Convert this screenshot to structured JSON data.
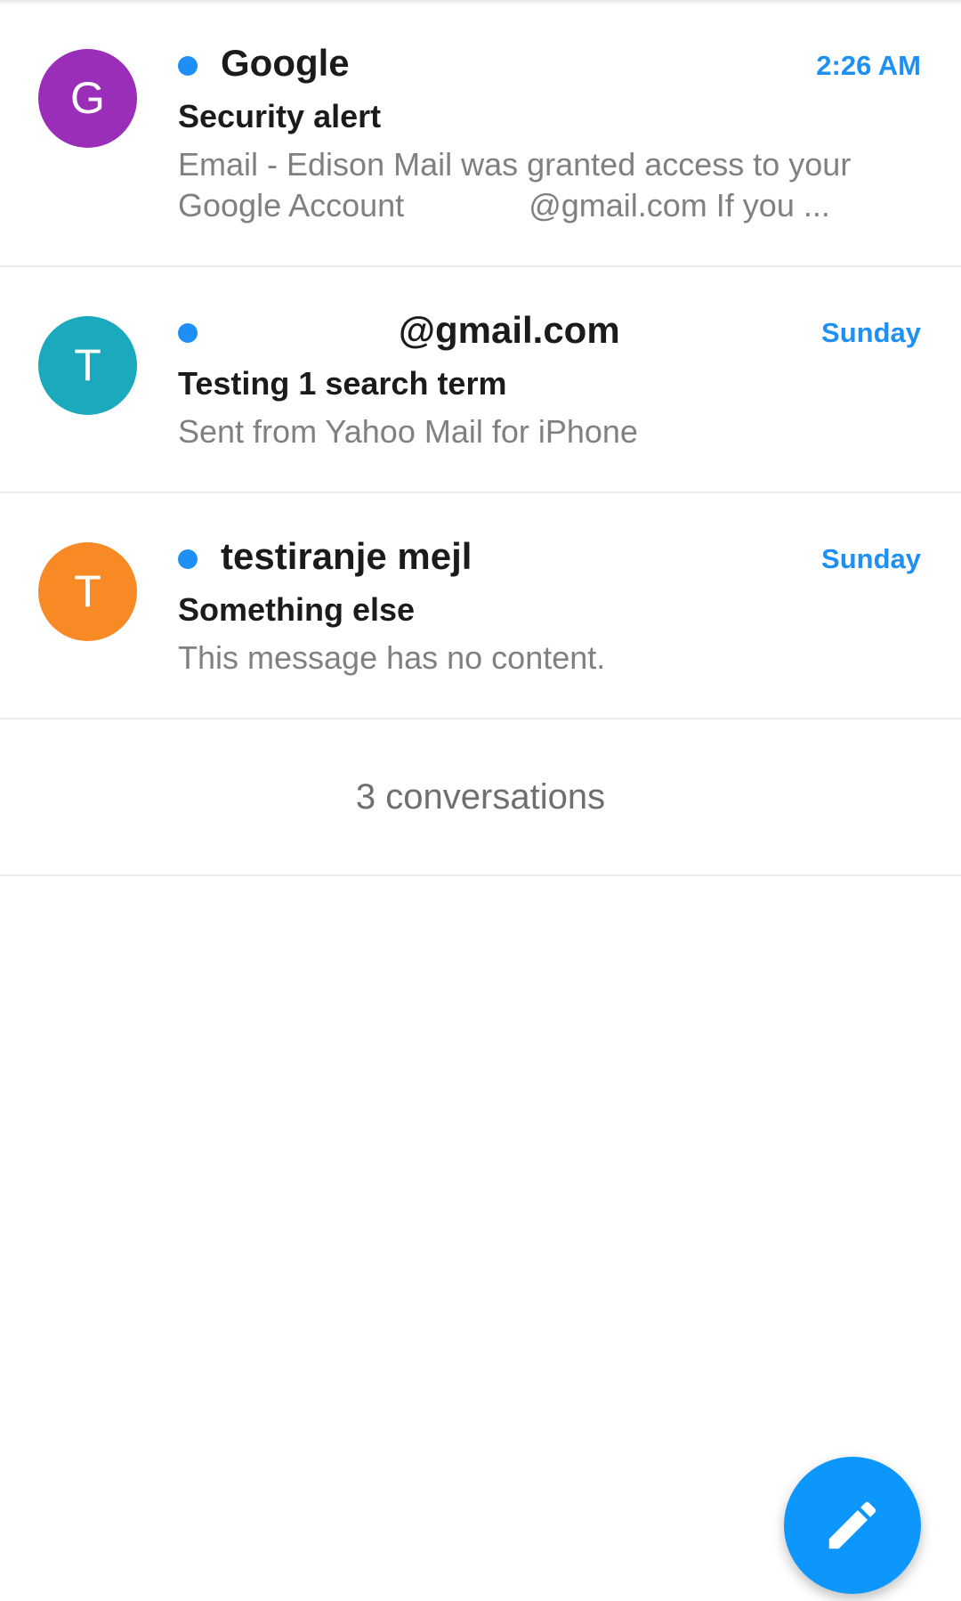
{
  "colors": {
    "accent": "#1e90f5",
    "unread_dot": "#1e90f5",
    "avatar_purple": "#9a2eb8",
    "avatar_teal": "#1aa9bd",
    "avatar_orange": "#f78a25",
    "fab": "#0d96fb"
  },
  "mails": [
    {
      "avatar_letter": "G",
      "avatar_color": "#9a2eb8",
      "unread": true,
      "sender": "Google",
      "time": "2:26 AM",
      "subject": "Security alert",
      "preview_line1": "Email - Edison Mail was granted access to your",
      "preview_line2": "Google Account              @gmail.com If you ..."
    },
    {
      "avatar_letter": "T",
      "avatar_color": "#1aa9bd",
      "unread": true,
      "sender": "@gmail.com",
      "time": "Sunday",
      "subject": "Testing 1 search term",
      "preview_line1": "Sent from Yahoo Mail for iPhone"
    },
    {
      "avatar_letter": "T",
      "avatar_color": "#f78a25",
      "unread": true,
      "sender": "testiranje mejl",
      "time": "Sunday",
      "subject": "Something else",
      "preview_line1": "This message has no content."
    }
  ],
  "footer": {
    "count_label": "3 conversations"
  },
  "fab": {
    "icon": "pencil-icon"
  }
}
